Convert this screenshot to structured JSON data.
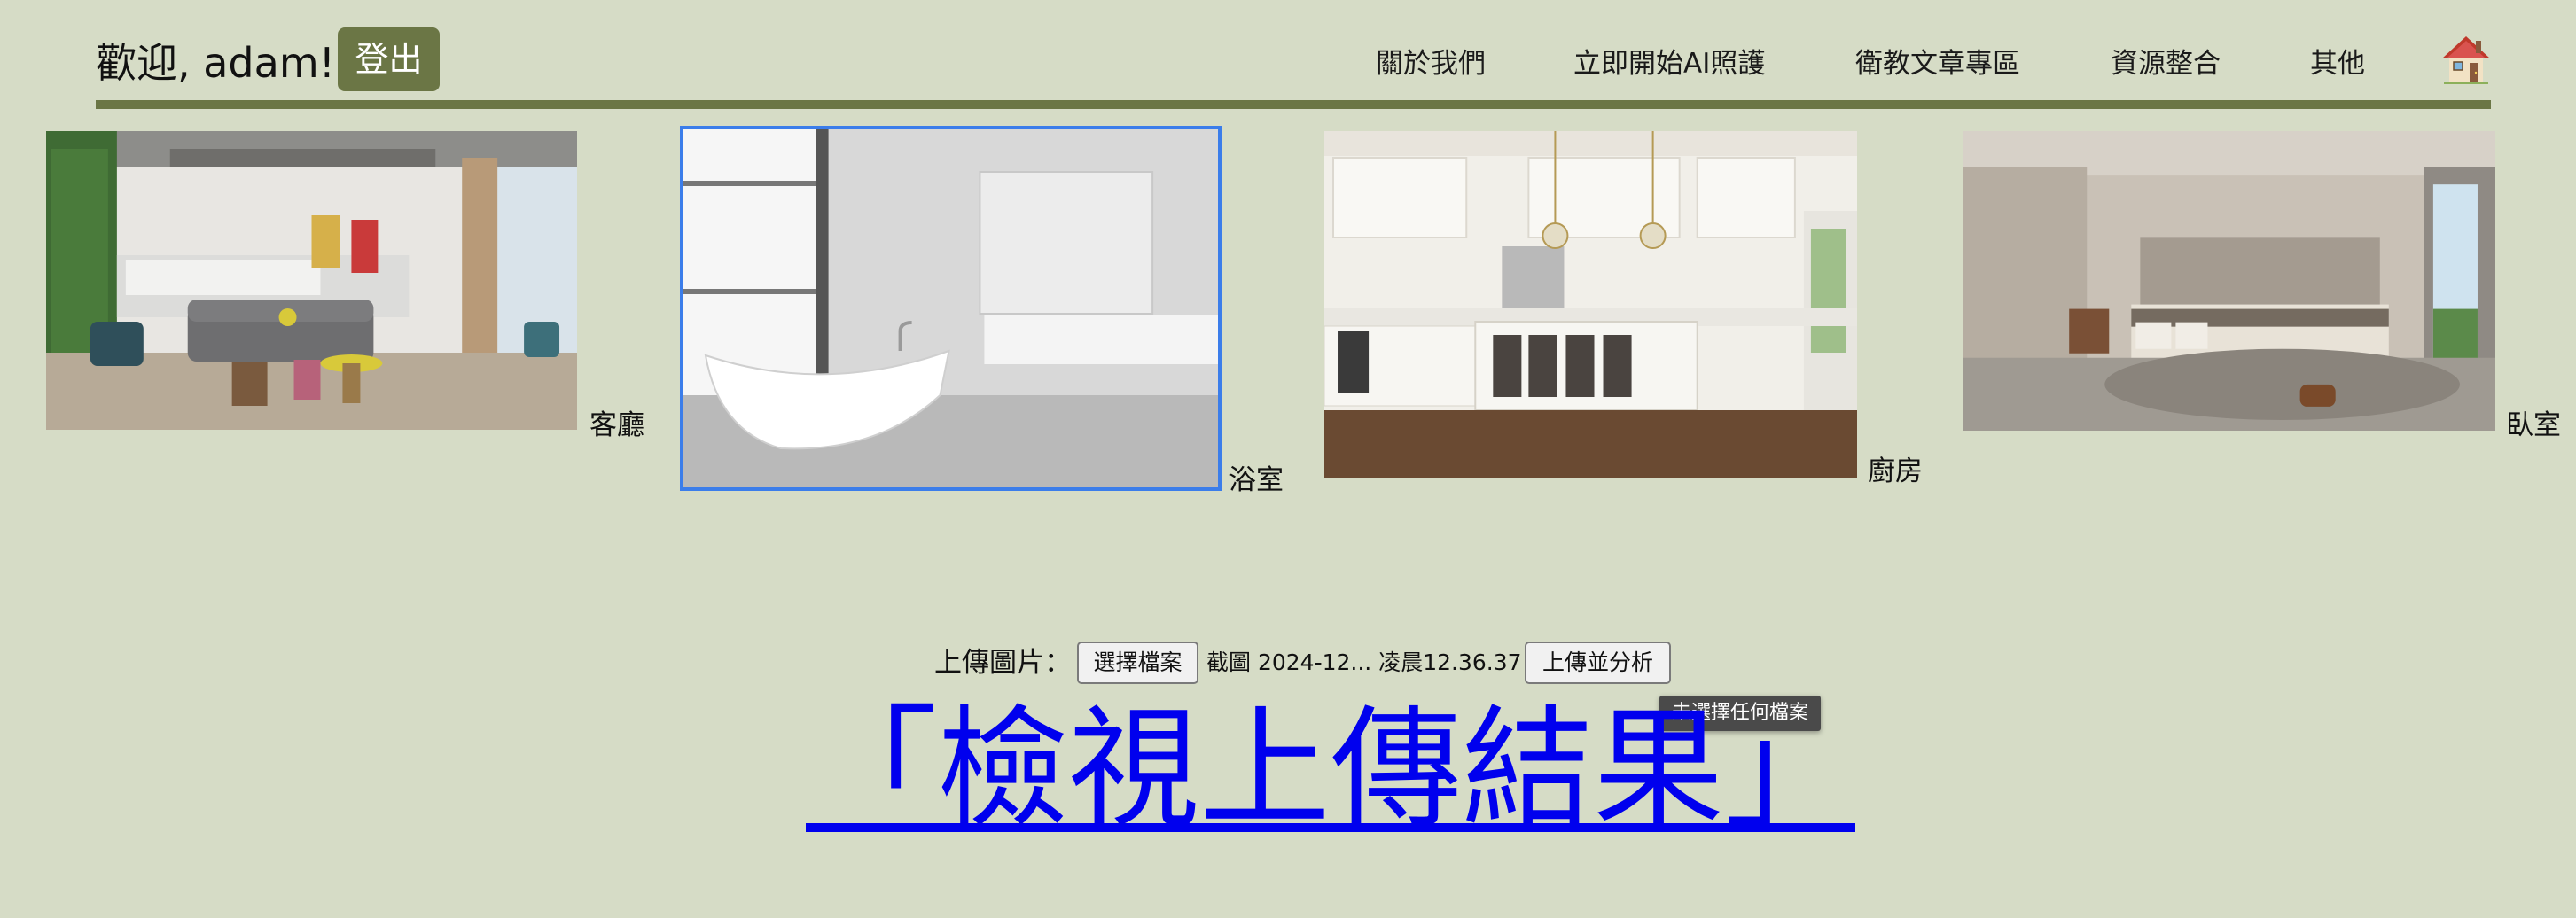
{
  "header": {
    "greeting": "歡迎, adam!",
    "logout_label": "登出",
    "nav": [
      {
        "label": "關於我們"
      },
      {
        "label": "立即開始AI照護"
      },
      {
        "label": "衛教文章專區"
      },
      {
        "label": "資源整合"
      },
      {
        "label": "其他"
      }
    ],
    "home_icon": "house-icon"
  },
  "rooms": [
    {
      "label": "客廳",
      "image": "living-room-photo",
      "selected": false
    },
    {
      "label": "浴室",
      "image": "bathroom-photo",
      "selected": true
    },
    {
      "label": "廚房",
      "image": "kitchen-photo",
      "selected": false
    },
    {
      "label": "臥室",
      "image": "bedroom-photo",
      "selected": false
    }
  ],
  "upload": {
    "label": "上傳圖片：",
    "choose_file_label": "選擇檔案",
    "file_name": "截圖 2024-12... 凌晨12.36.37",
    "submit_label": "上傳並分析",
    "tooltip": "未選擇任何檔案"
  },
  "result_link": "「檢視上傳結果」",
  "colors": {
    "background": "#d6dcc6",
    "accent": "#6b7645",
    "link": "#0000ee",
    "selection": "#3b7dea"
  }
}
